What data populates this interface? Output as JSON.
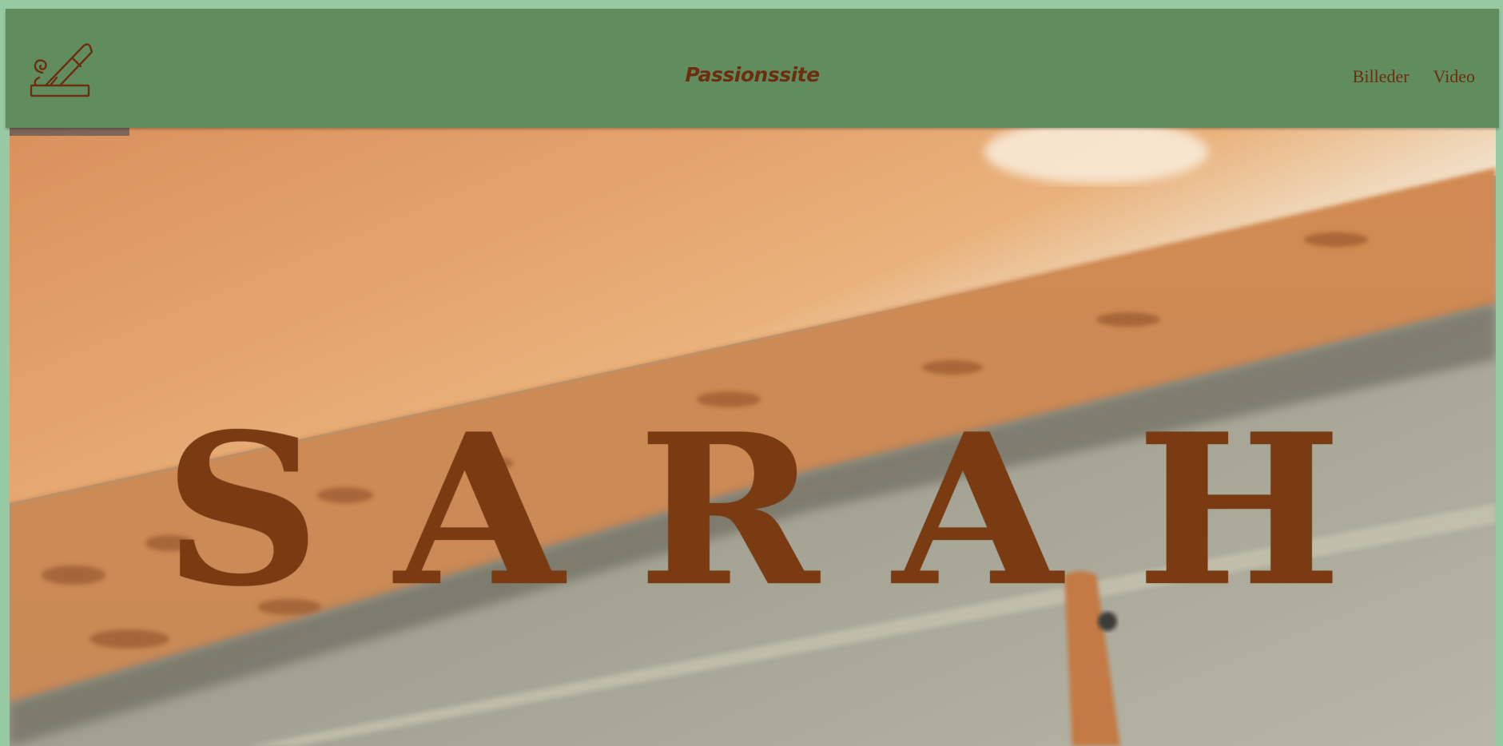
{
  "header": {
    "logo_icon": "wood-plane-icon",
    "site_title": "Passionssite",
    "nav": [
      {
        "label": "Billeder"
      },
      {
        "label": "Video"
      }
    ]
  },
  "hero": {
    "title": "SARAH",
    "background": "wooden-tabletop-photo"
  },
  "colors": {
    "page_background": "#97c9a2",
    "header_background": "#618d5e",
    "text_brown": "#6b2f10",
    "hero_title": "#7a3b12"
  }
}
